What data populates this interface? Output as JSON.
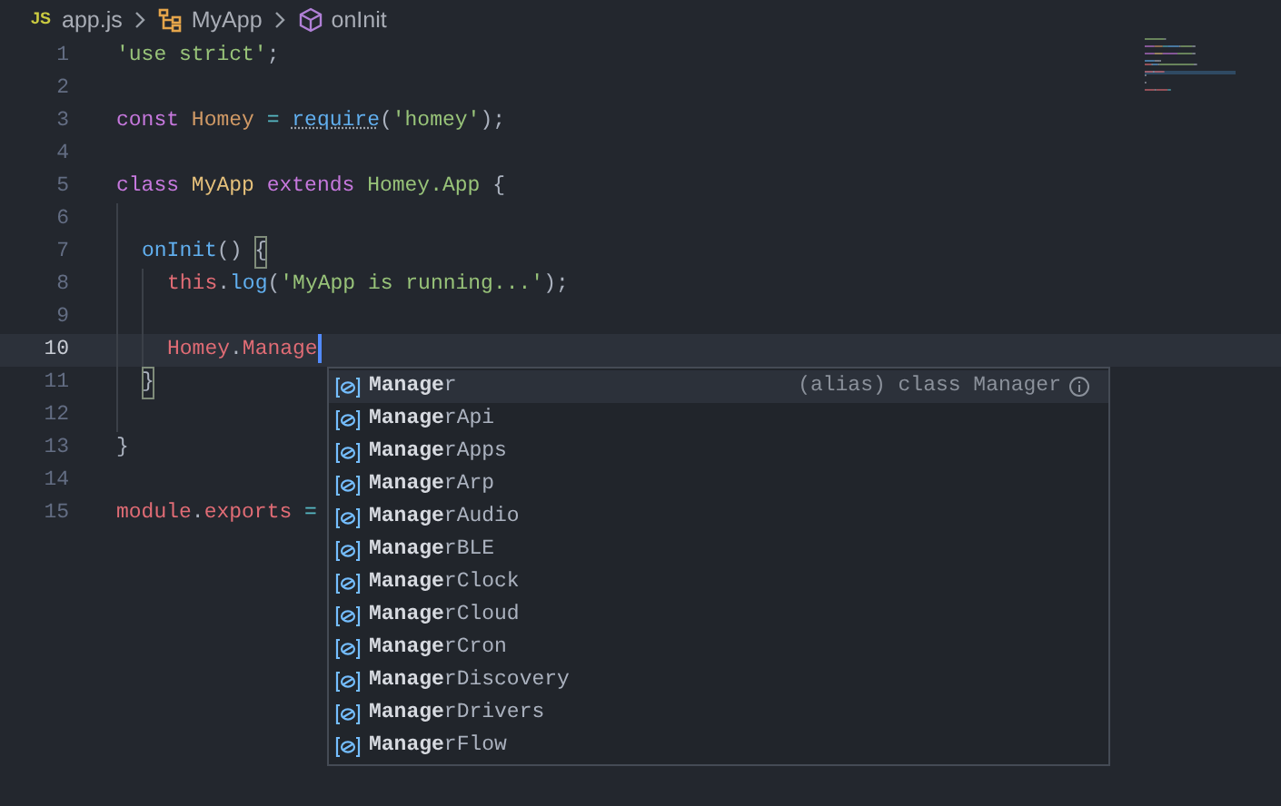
{
  "breadcrumbs": {
    "file_badge": "JS",
    "items": [
      {
        "kind": "file",
        "label": "app.js"
      },
      {
        "kind": "class",
        "label": "MyApp"
      },
      {
        "kind": "method",
        "label": "onInit"
      }
    ]
  },
  "lines": [
    {
      "number": "1",
      "current": false,
      "tokens": [
        {
          "kind": "string",
          "text": "'use strict'"
        },
        {
          "kind": "plain",
          "text": ";"
        }
      ]
    },
    {
      "number": "2",
      "current": false
    },
    {
      "number": "3",
      "current": false,
      "tokens": [
        {
          "kind": "keyword",
          "text": "const "
        },
        {
          "kind": "variable",
          "text": "Homey"
        },
        {
          "kind": "operator",
          "text": " = "
        },
        {
          "kind": "function",
          "text": "require",
          "hint": true
        },
        {
          "kind": "plain",
          "text": "("
        },
        {
          "kind": "string",
          "text": "'homey'"
        },
        {
          "kind": "plain",
          "text": ");"
        }
      ]
    },
    {
      "number": "4",
      "current": false
    },
    {
      "number": "5",
      "current": false,
      "tokens": [
        {
          "kind": "keyword",
          "text": "class "
        },
        {
          "kind": "class",
          "text": "MyApp"
        },
        {
          "kind": "keyword",
          "text": " extends "
        },
        {
          "kind": "type",
          "text": "Homey.App"
        },
        {
          "kind": "plain",
          "text": " {"
        }
      ],
      "children": [
        {
          "number": "6",
          "current": false
        },
        {
          "number": "7",
          "current": false,
          "tokens": [
            {
              "kind": "function",
              "text": "onInit"
            },
            {
              "kind": "plain",
              "text": "() "
            },
            {
              "kind": "plain",
              "text": "{",
              "bracket_match": true
            }
          ],
          "children": [
            {
              "number": "8",
              "current": false,
              "tokens": [
                {
                  "kind": "property",
                  "text": "this"
                },
                {
                  "kind": "plain",
                  "text": "."
                },
                {
                  "kind": "function",
                  "text": "log"
                },
                {
                  "kind": "plain",
                  "text": "("
                },
                {
                  "kind": "string",
                  "text": "'MyApp is running...'"
                },
                {
                  "kind": "plain",
                  "text": ");"
                }
              ]
            },
            {
              "number": "9",
              "current": false
            },
            {
              "number": "10",
              "current": true,
              "tokens": [
                {
                  "kind": "property",
                  "text": "Homey"
                },
                {
                  "kind": "plain",
                  "text": "."
                },
                {
                  "kind": "property",
                  "text": "Manage"
                }
              ]
            }
          ]
        },
        {
          "number": "11",
          "current": false,
          "tokens": [
            {
              "kind": "plain",
              "text": "}",
              "bracket_match": true
            }
          ]
        },
        {
          "number": "12",
          "current": false
        }
      ]
    },
    {
      "number": "13",
      "current": false,
      "tokens": [
        {
          "kind": "plain",
          "text": "}"
        }
      ]
    },
    {
      "number": "14",
      "current": false
    },
    {
      "number": "15",
      "current": false,
      "tokens": [
        {
          "kind": "property",
          "text": "module"
        },
        {
          "kind": "plain",
          "text": "."
        },
        {
          "kind": "property",
          "text": "exports"
        },
        {
          "kind": "operator",
          "text": " ="
        }
      ]
    }
  ],
  "suggestions": [
    {
      "match": "Manage",
      "rest": "r",
      "selected": true,
      "detail": "(alias) class Manager"
    },
    {
      "match": "Manage",
      "rest": "rApi",
      "selected": false
    },
    {
      "match": "Manage",
      "rest": "rApps",
      "selected": false
    },
    {
      "match": "Manage",
      "rest": "rArp",
      "selected": false
    },
    {
      "match": "Manage",
      "rest": "rAudio",
      "selected": false
    },
    {
      "match": "Manage",
      "rest": "rBLE",
      "selected": false
    },
    {
      "match": "Manage",
      "rest": "rClock",
      "selected": false
    },
    {
      "match": "Manage",
      "rest": "rCloud",
      "selected": false
    },
    {
      "match": "Manage",
      "rest": "rCron",
      "selected": false
    },
    {
      "match": "Manage",
      "rest": "rDiscovery",
      "selected": false
    },
    {
      "match": "Manage",
      "rest": "rDrivers",
      "selected": false
    },
    {
      "match": "Manage",
      "rest": "rFlow",
      "selected": false
    }
  ]
}
